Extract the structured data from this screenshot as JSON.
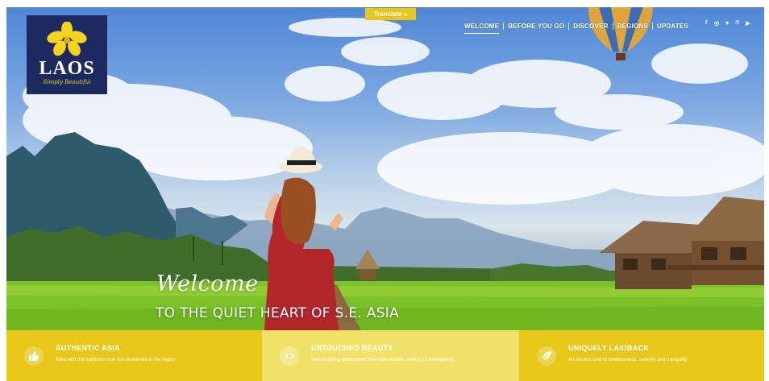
{
  "colors": {
    "logo_bg": "#1c2a5f",
    "accent_yellow": "#e6c71a",
    "feature_1_bg": "#e6c71a",
    "feature_2_bg": "#f0e268",
    "feature_3_bg": "#e6c71a"
  },
  "logo": {
    "word": "LAOS",
    "tagline": "Simply Beautiful",
    "icon": "frangipani-flower-icon"
  },
  "translate": {
    "label": "Translate »"
  },
  "nav": {
    "items": [
      {
        "label": "WELCOME",
        "active": true
      },
      {
        "label": "BEFORE YOU GO",
        "active": false
      },
      {
        "label": "DISCOVER",
        "active": false
      },
      {
        "label": "REGIONS",
        "active": false
      },
      {
        "label": "UPDATES",
        "active": false
      }
    ]
  },
  "social": [
    {
      "name": "facebook-icon",
      "glyph": "f"
    },
    {
      "name": "instagram-icon",
      "glyph": "◎"
    },
    {
      "name": "twitter-icon",
      "glyph": "✦"
    },
    {
      "name": "pinterest-icon",
      "glyph": "℗"
    },
    {
      "name": "youtube-icon",
      "glyph": "▶"
    }
  ],
  "hero": {
    "welcome": "Welcome",
    "tagline": "TO THE QUIET HEART OF S.E. ASIA"
  },
  "features": [
    {
      "title": "AUTHENTIC ASIA",
      "desc": "Alive with the traditions now lost elsewhere in the region",
      "icon": "thumbs-up-icon"
    },
    {
      "title": "UNTOUCHED BEAUTY",
      "desc": "Awe-inspiring landscapes filled with wonder, waiting to be explored",
      "icon": "eye-icon"
    },
    {
      "title": "UNIQUELY LAIDBACK",
      "desc": "An ancient land of timelessness, serenity and tranquility",
      "icon": "leaf-icon"
    }
  ]
}
